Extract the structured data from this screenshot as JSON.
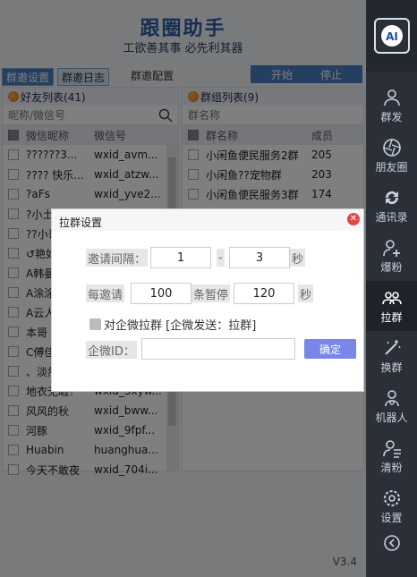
{
  "header": {
    "title": "跟圈助手",
    "subtitle": "工欲善其事 必先利其器"
  },
  "tabs": [
    {
      "label": "群邀设置"
    },
    {
      "label": "群邀日志"
    }
  ],
  "tab_title": "群邀配置",
  "buttons": {
    "start": "开始",
    "stop": "停止"
  },
  "friends": {
    "title": "好友列表(41)",
    "search_placeholder": "昵称/微信号",
    "col_nick": "微信昵称",
    "col_id": "微信号",
    "rows": [
      {
        "nick": "  ??????3...",
        "id": "wxid_avm..."
      },
      {
        "nick": "???? 快乐...",
        "id": "wxid_atzw..."
      },
      {
        "nick": "?aFs",
        "id": "wxid_yve2..."
      },
      {
        "nick": "?小土",
        "id": ""
      },
      {
        "nick": "??小哥",
        "id": ""
      },
      {
        "nick": "↺艳如",
        "id": ""
      },
      {
        "nick": "A韩曼",
        "id": ""
      },
      {
        "nick": "A涂涂",
        "id": ""
      },
      {
        "nick": "A云人",
        "id": ""
      },
      {
        "nick": "本哥",
        "id": ""
      },
      {
        "nick": "C傅佳",
        "id": ""
      },
      {
        "nick": "、淡然",
        "id": ""
      },
      {
        "nick": "地衣无暇！",
        "id": "wxid_3xyw..."
      },
      {
        "nick": "风风的秋",
        "id": "wxid_bww..."
      },
      {
        "nick": "河豚",
        "id": "wxid_9fpf..."
      },
      {
        "nick": "Huabin",
        "id": "huanghua..."
      },
      {
        "nick": "今天不敢夜",
        "id": "wxid_704i..."
      }
    ]
  },
  "groups": {
    "title": "群组列表(9)",
    "search_placeholder": "群名称",
    "col_name": "群名称",
    "col_members": "成员",
    "rows": [
      {
        "name": "小闲鱼便民服务2群",
        "members": "205"
      },
      {
        "name": "小闲鱼??宠物群",
        "members": "203"
      },
      {
        "name": "小闲鱼便民服务3群",
        "members": "174"
      }
    ]
  },
  "sidebar": {
    "items": [
      {
        "label": "群发",
        "icon": "group-send-icon"
      },
      {
        "label": "朋友圈",
        "icon": "aperture-icon"
      },
      {
        "label": "通讯录",
        "icon": "sync-icon"
      },
      {
        "label": "爆粉",
        "icon": "add-user-icon"
      },
      {
        "label": "拉群",
        "icon": "pull-group-icon"
      },
      {
        "label": "换群",
        "icon": "magic-icon"
      },
      {
        "label": "机器人",
        "icon": "robot-icon"
      },
      {
        "label": "清粉",
        "icon": "clear-user-icon"
      },
      {
        "label": "设置",
        "icon": "gear-icon"
      }
    ],
    "active": "拉群"
  },
  "version": "V3.4",
  "dialog": {
    "title": "拉群设置",
    "interval_label": "邀请间隔：",
    "interval_min": "1",
    "dash": "-",
    "interval_max": "3",
    "seconds": "秒",
    "per_label": "每邀请",
    "per_value": "100",
    "pause_label": "条暂停",
    "pause_value": "120",
    "seconds2": "秒",
    "wecom_check_label": "对企微拉群 [企微发送：拉群]",
    "wecom_id_label": "企微ID：",
    "wecom_id_value": "",
    "confirm": "确定"
  }
}
